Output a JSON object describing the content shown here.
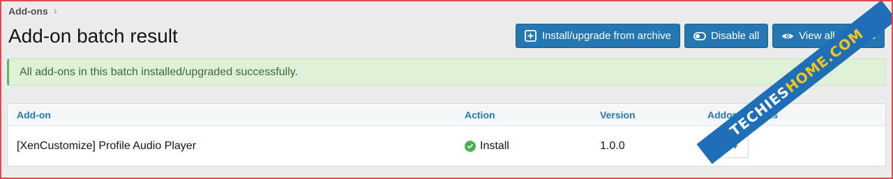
{
  "breadcrumb": {
    "root": "Add-ons",
    "separator": "›"
  },
  "page": {
    "title": "Add-on batch result"
  },
  "toolbar": {
    "install_label": "Install/upgrade from archive",
    "disable_label": "Disable all",
    "view_label": "View all add-ons"
  },
  "alert": {
    "message": "All add-ons in this batch installed/upgraded successfully."
  },
  "table": {
    "headers": [
      "Add-on",
      "Action",
      "Version",
      "Addon Options"
    ],
    "rows": [
      {
        "addon": "[XenCustomize] Profile Audio Player",
        "action": "Install",
        "version": "1.0.0"
      }
    ]
  },
  "watermark": {
    "prefix": "TECHIES",
    "suffix": "HOME.COM"
  },
  "colors": {
    "accent": "#2577b1",
    "success": "#4caf50",
    "alert_bg": "#dff0d8",
    "frame": "#e5484d"
  }
}
